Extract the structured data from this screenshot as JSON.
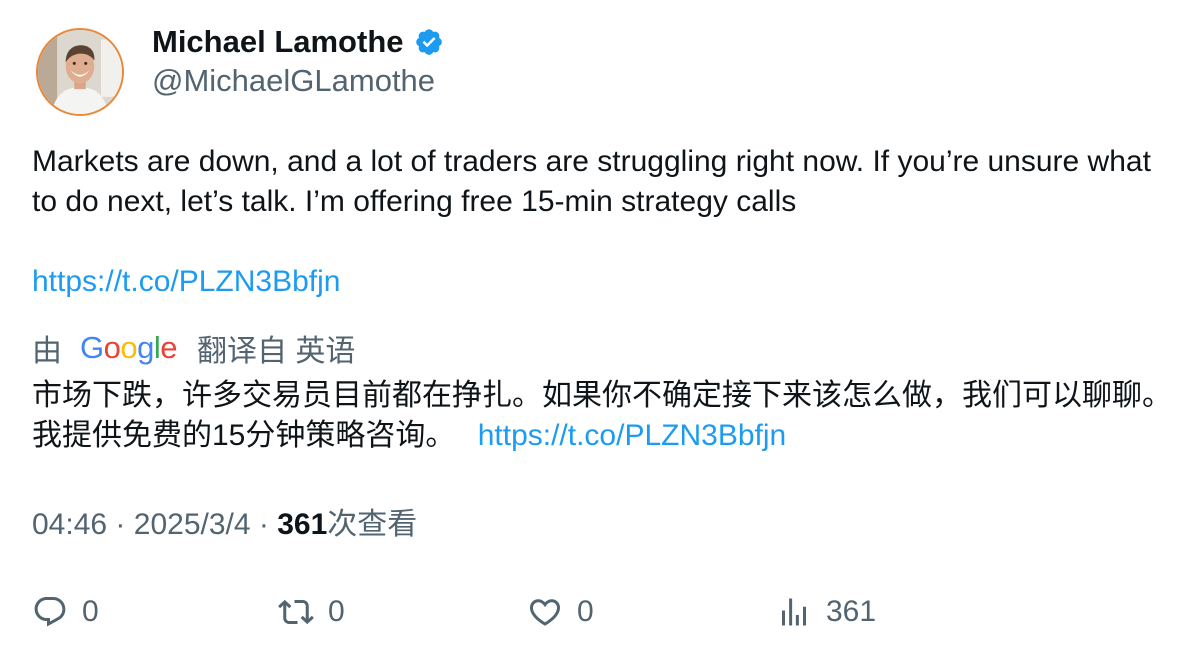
{
  "author": {
    "display_name": "Michael Lamothe",
    "handle": "@MichaelGLamothe",
    "verified": true,
    "avatar_icon": "profile-photo"
  },
  "tweet": {
    "text": "Markets are down, and a lot of traders are struggling right now. If you’re unsure what to do next, let’s talk. I’m offering free 15-min strategy calls",
    "link": "https://t.co/PLZN3Bbfjn"
  },
  "translation": {
    "by": "由",
    "provider": "Google",
    "from": "翻译自 英语",
    "text": "市场下跌，许多交易员目前都在挣扎。如果你不确定接下来该怎么做，我们可以聊聊。我提供免费的15分钟策略咨询。",
    "link": "https://t.co/PLZN3Bbfjn"
  },
  "meta": {
    "time": "04:46",
    "separator": "·",
    "date": "2025/3/4",
    "views": "361",
    "views_label": "次查看"
  },
  "actions": {
    "replies": "0",
    "retweets": "0",
    "likes": "0",
    "views": "361"
  },
  "colors": {
    "link": "#1d9bf0",
    "secondary_text": "#536471",
    "primary_text": "#0f1419",
    "verified_badge": "#1d9bf0",
    "avatar_ring": "#e8893a"
  }
}
